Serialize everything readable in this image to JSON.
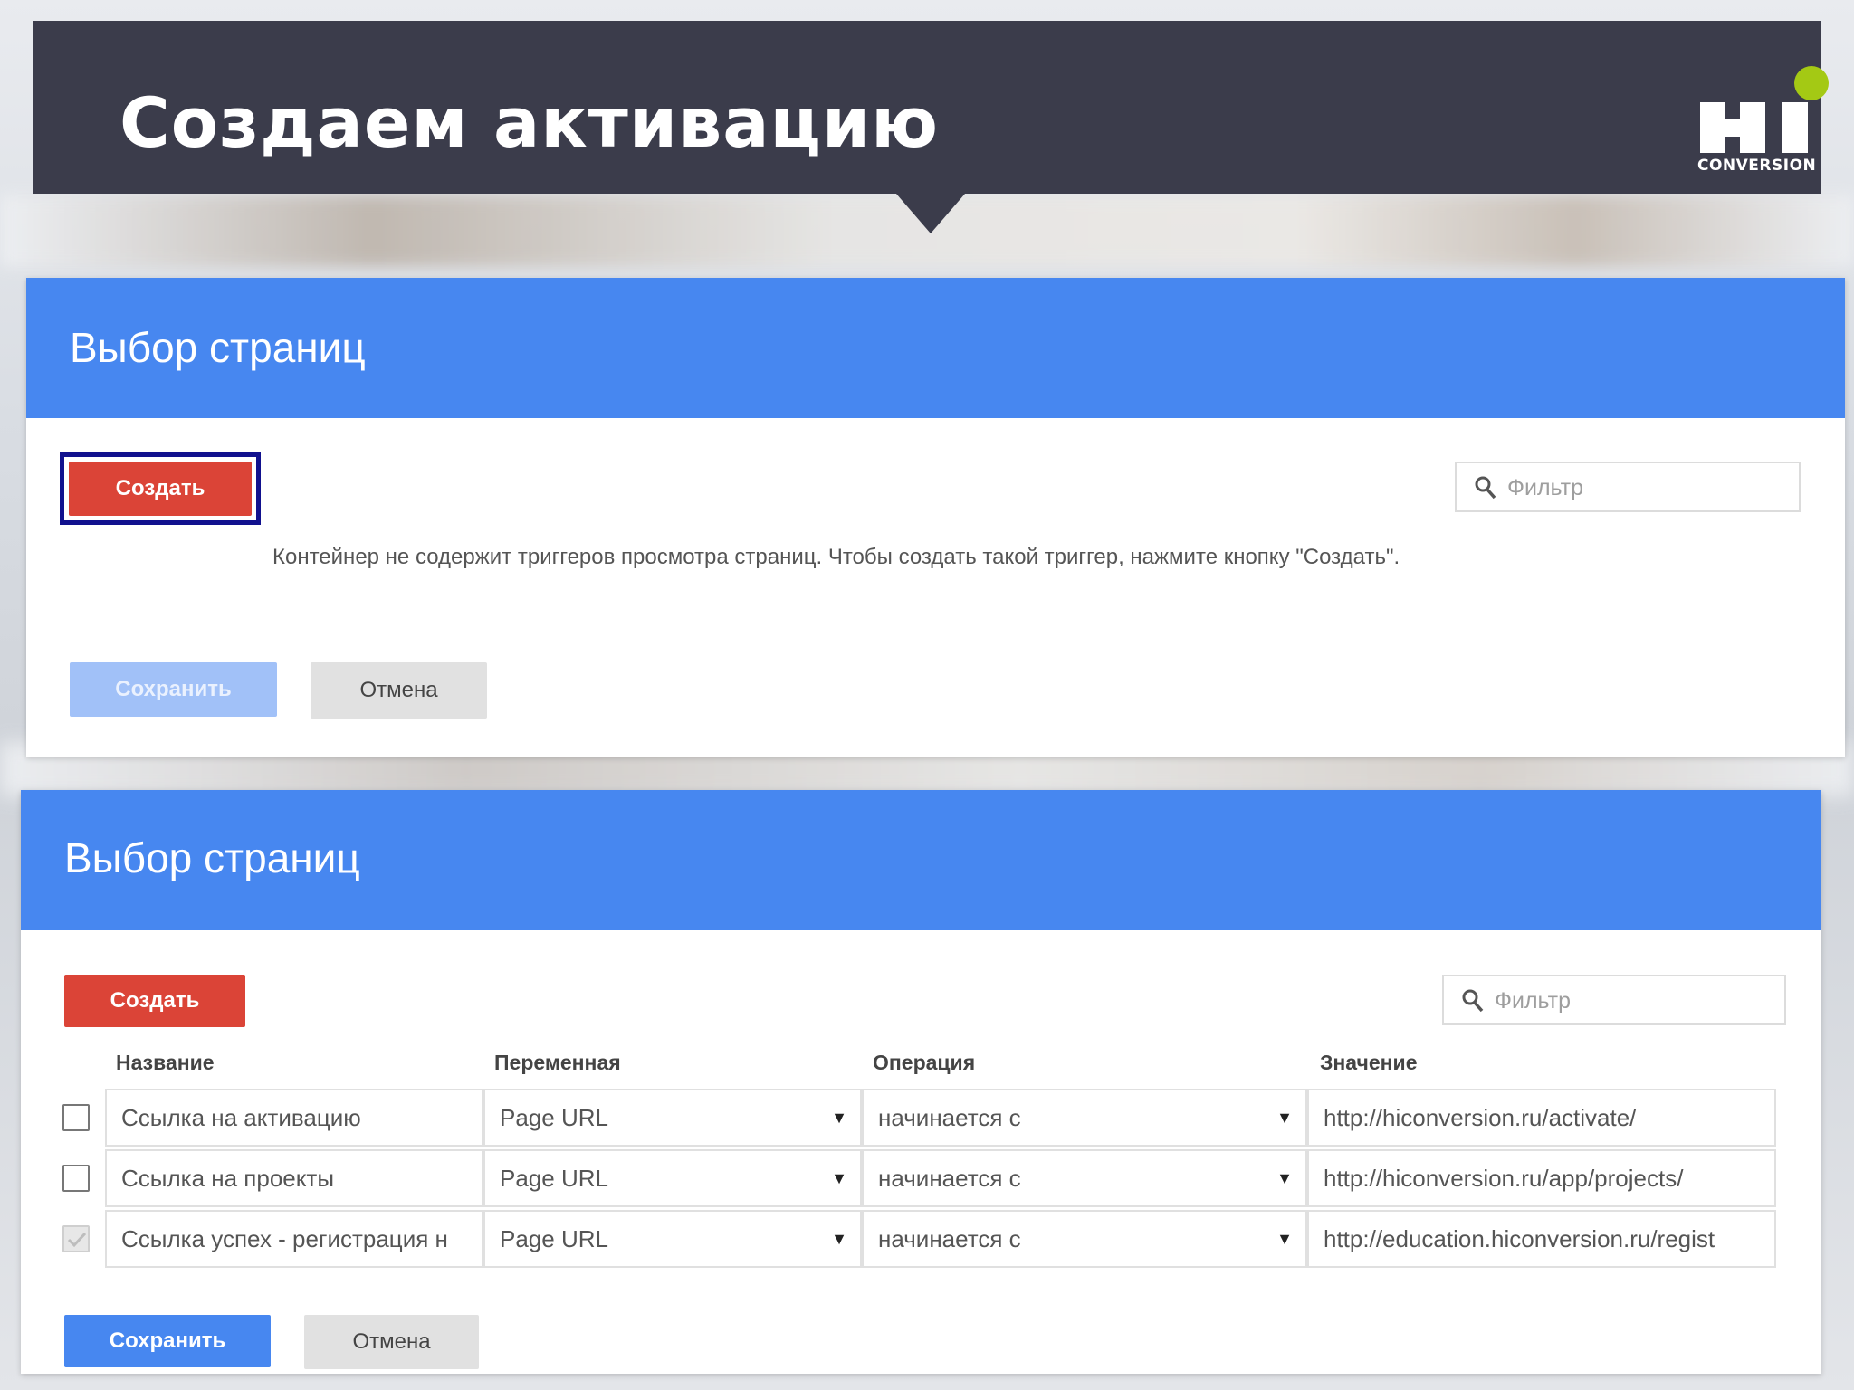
{
  "slide": {
    "title": "Создаем активацию",
    "logo_text": "CONVERSION",
    "logo_accent_color": "#a4c914"
  },
  "panel_top": {
    "title": "Выбор страниц",
    "create_label": "Создать",
    "filter_placeholder": "Фильтр",
    "empty_message": "Контейнер не содержит триггеров просмотра страниц. Чтобы создать такой триггер, нажмите кнопку \"Создать\".",
    "save_label": "Сохранить",
    "cancel_label": "Отмена"
  },
  "panel_bottom": {
    "title": "Выбор страниц",
    "create_label": "Создать",
    "filter_placeholder": "Фильтр",
    "columns": [
      "Название",
      "Переменная",
      "Операция",
      "Значение"
    ],
    "rows": [
      {
        "checked": false,
        "name": "Ссылка на активацию",
        "variable": "Page URL",
        "operation": "начинается с",
        "value": "http://hiconversion.ru/activate/"
      },
      {
        "checked": false,
        "name": "Ссылка на проекты",
        "variable": "Page URL",
        "operation": "начинается с",
        "value": "http://hiconversion.ru/app/projects/"
      },
      {
        "checked": true,
        "name": "Ссылка успех - регистрация н",
        "variable": "Page URL",
        "operation": "начинается с",
        "value": "http://education.hiconversion.ru/regist"
      }
    ],
    "save_label": "Сохранить",
    "cancel_label": "Отмена"
  },
  "colors": {
    "banner": "#3b3c4b",
    "panel_header_blue": "#4787f0",
    "create_red": "#db4437",
    "focus_ring": "#11118e"
  }
}
